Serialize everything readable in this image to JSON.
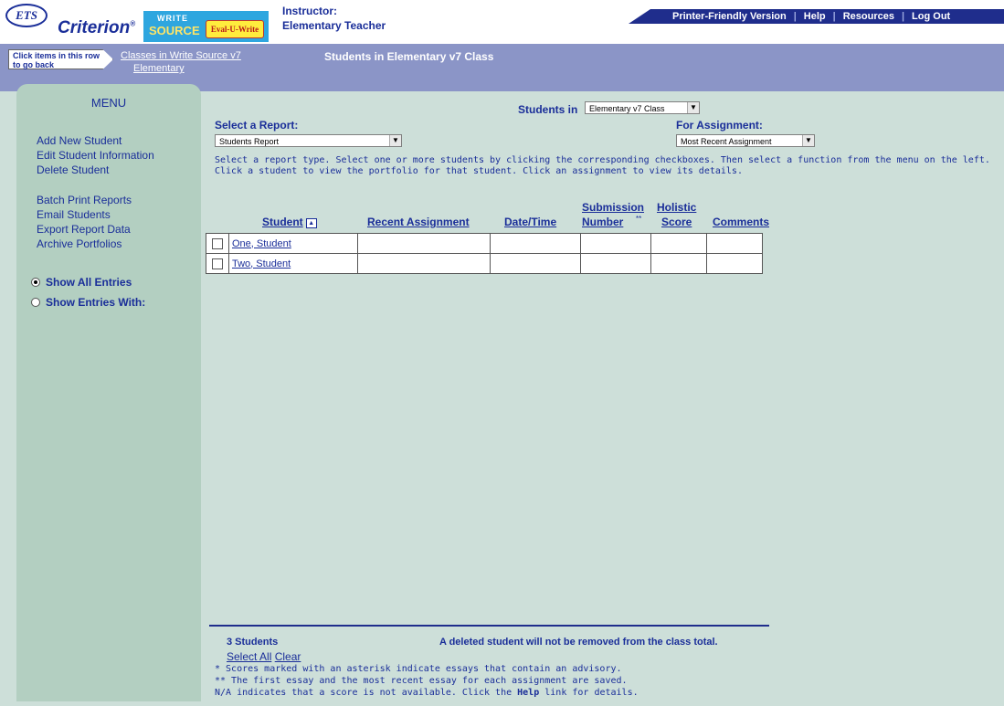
{
  "header": {
    "logo_ets": "ETS",
    "logo_criterion": "Criterion",
    "logo_write": "WRITE",
    "logo_source": "SOURCE",
    "logo_evaluwrite": "Eval-U-Write",
    "instructor_label": "Instructor:",
    "instructor_name": "Elementary Teacher",
    "nav": [
      "Printer-Friendly Version",
      "Help",
      "Resources",
      "Log Out"
    ]
  },
  "breadcrumb": {
    "back_hint": "Click items in this row to go back",
    "link_line1": "Classes in Write Source v7",
    "link_line2": "Elementary",
    "current": "Students in Elementary v7 Class"
  },
  "menu": {
    "title": "MENU",
    "group1": [
      "Add New Student",
      "Edit Student Information",
      "Delete Student"
    ],
    "group2": [
      "Batch Print Reports",
      "Email Students",
      "Export Report Data",
      "Archive Portfolios"
    ],
    "radio_all": "Show All Entries",
    "radio_with": "Show Entries With:"
  },
  "controls": {
    "students_in_label": "Students in",
    "class_value": "Elementary v7 Class",
    "report_label": "Select a Report:",
    "report_value": "Students Report",
    "assignment_label": "For Assignment:",
    "assignment_value": "Most Recent Assignment"
  },
  "instructions": "Select a report type. Select one or more students by clicking the corresponding checkboxes. Then select a function from the menu on the left. Click a student to view the portfolio for that student. Click an assignment to view its details.",
  "table": {
    "headers": {
      "student": "Student",
      "recent_assignment": "Recent Assignment",
      "datetime": "Date/Time",
      "submission_1": "Submission",
      "submission_2": "Number",
      "holistic_1": "Holistic",
      "holistic_2": "Score",
      "comments": "Comments"
    },
    "rows": [
      {
        "student": "One, Student"
      },
      {
        "student": "Two, Student"
      }
    ]
  },
  "footer": {
    "count": "3 Students",
    "deleted_note": "A deleted student will not be removed from the class total.",
    "select_all": "Select All",
    "clear": "Clear",
    "note1": "* Scores marked with an asterisk indicate essays that contain an advisory.",
    "note2": "** The first essay and the most recent essay for each assignment are saved.",
    "note3_pre": "N/A indicates that a score is not available. Click the",
    "note3_help": "Help",
    "note3_post": "link for details."
  },
  "colors": {
    "brand_blue": "#1a2e99",
    "nav_bar": "#1f2d8c",
    "breadcrumb_bg": "#8b95c7",
    "content_bg": "#cddfd9",
    "menu_bg": "#b3cfc1"
  }
}
